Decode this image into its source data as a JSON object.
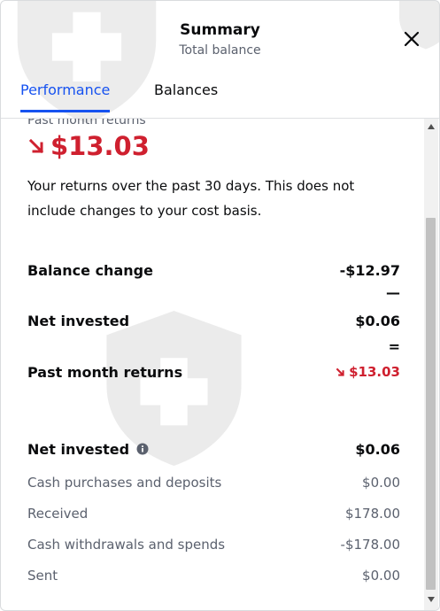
{
  "header": {
    "title": "Summary",
    "subtitle": "Total balance"
  },
  "tabs": [
    {
      "label": "Performance",
      "active": true
    },
    {
      "label": "Balances",
      "active": false
    }
  ],
  "performance": {
    "period_label": "Past month returns",
    "return_value": "$13.03",
    "description": "Your returns over the past 30 days. This does not include changes to your cost basis.",
    "rows": [
      {
        "label": "Balance change",
        "value": "-$12.97"
      },
      {
        "operator": "—"
      },
      {
        "label": "Net invested",
        "value": "$0.06"
      },
      {
        "operator": "="
      },
      {
        "label": "Past month returns",
        "value": "$13.03"
      }
    ],
    "net_invested": {
      "label": "Net invested",
      "value": "$0.06",
      "items": [
        {
          "label": "Cash purchases and deposits",
          "value": "$0.00"
        },
        {
          "label": "Received",
          "value": "$178.00"
        },
        {
          "label": "Cash withdrawals and spends",
          "value": "-$178.00"
        },
        {
          "label": "Sent",
          "value": "$0.00"
        }
      ]
    }
  },
  "colors": {
    "accent": "#1652f0",
    "negative": "#cf202f",
    "muted": "#5b616e"
  }
}
